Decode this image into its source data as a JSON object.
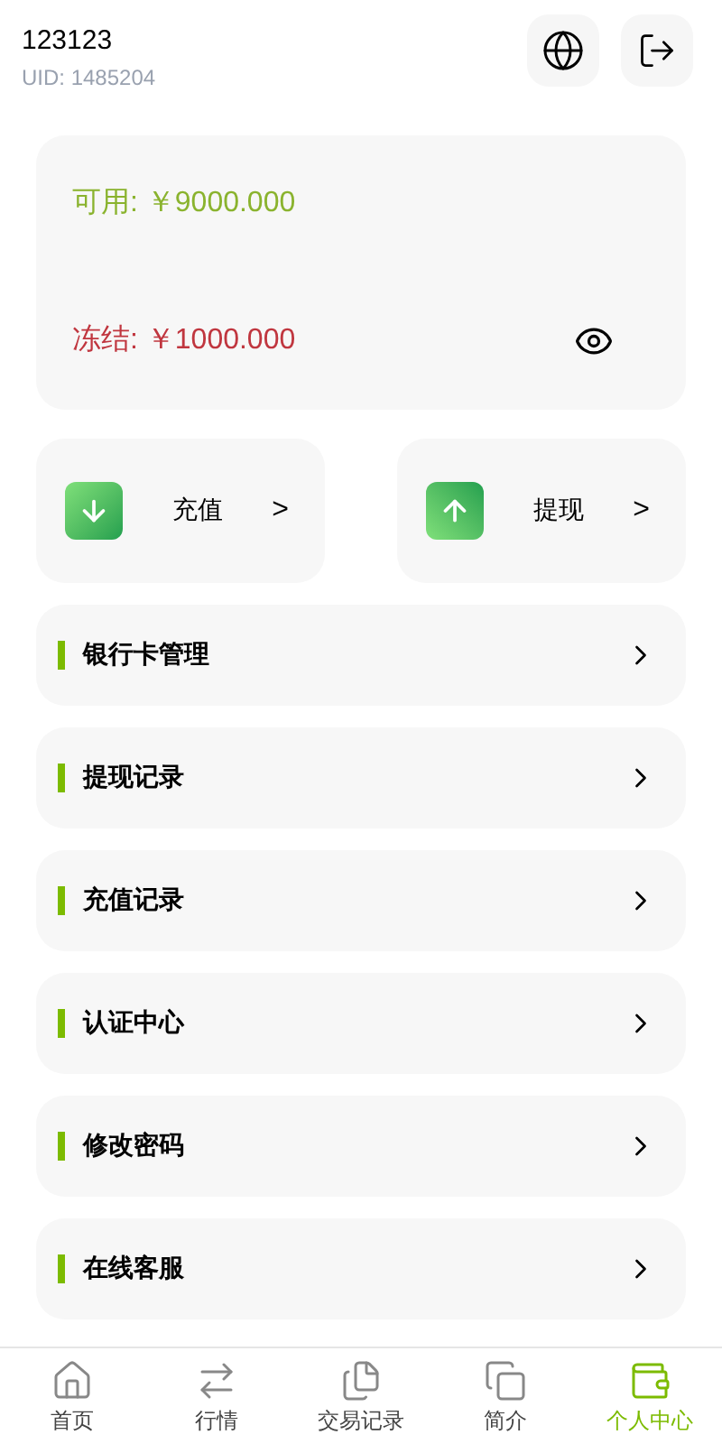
{
  "user": {
    "name": "123123",
    "uid": "UID: 1485204"
  },
  "balance": {
    "available": "可用: ￥9000.000",
    "frozen": "冻结: ￥1000.000"
  },
  "actions": [
    {
      "kind": "deposit",
      "label": "充值",
      "chevron": ">"
    },
    {
      "kind": "withdraw",
      "label": "提现",
      "chevron": ">"
    }
  ],
  "menu": [
    {
      "label": "银行卡管理"
    },
    {
      "label": "提现记录"
    },
    {
      "label": "充值记录"
    },
    {
      "label": "认证中心"
    },
    {
      "label": "修改密码"
    },
    {
      "label": "在线客服"
    }
  ],
  "tabs": [
    {
      "kind": "home",
      "label": "首页",
      "selected": false
    },
    {
      "kind": "market",
      "label": "行情",
      "selected": false
    },
    {
      "kind": "records",
      "label": "交易记录",
      "selected": false
    },
    {
      "kind": "about",
      "label": "简介",
      "selected": false
    },
    {
      "kind": "profile",
      "label": "个人中心",
      "selected": true
    }
  ]
}
